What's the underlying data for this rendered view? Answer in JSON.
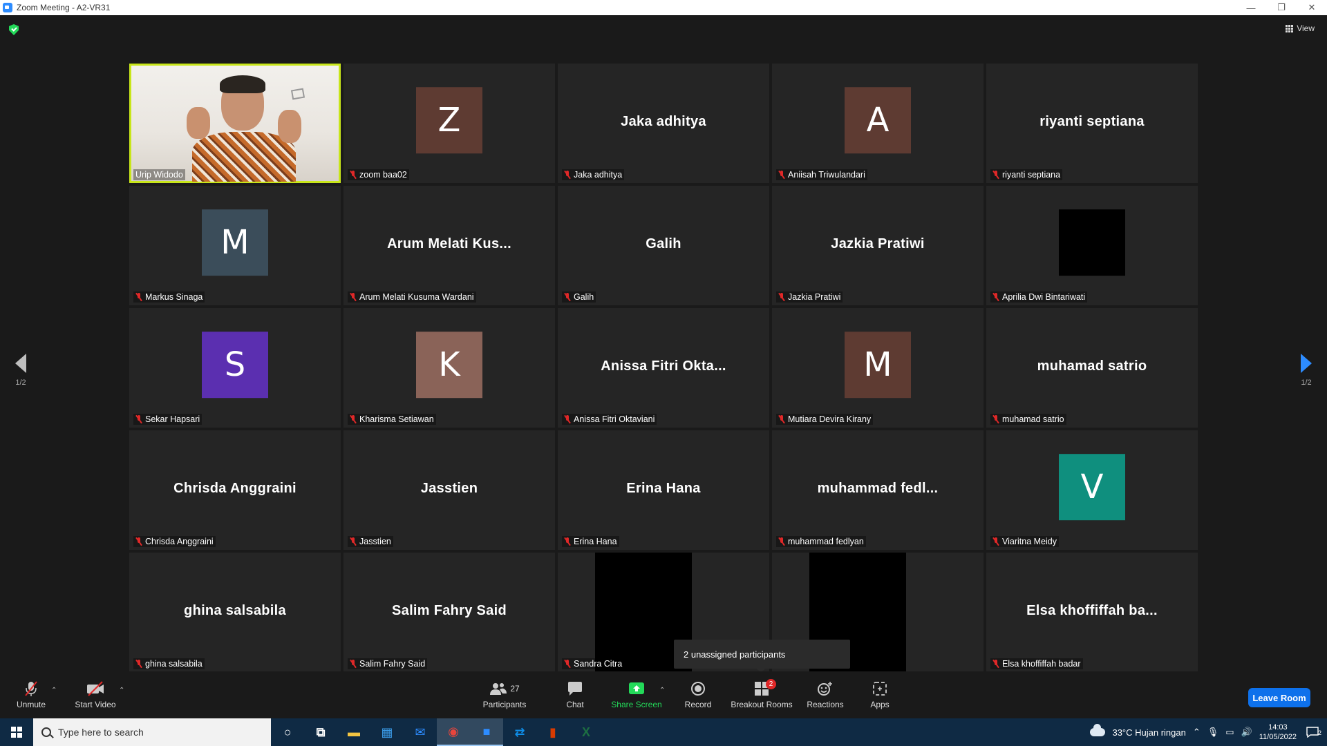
{
  "window": {
    "title": "Zoom Meeting - A2-VR31",
    "min_glyph": "—",
    "max_glyph": "❐",
    "close_glyph": "✕"
  },
  "meeting": {
    "view_label": "View",
    "page_indicator_left": "1/2",
    "page_indicator_right": "1/2",
    "tooltip": "2 unassigned participants"
  },
  "colors": {
    "active_border": "#c8e61a",
    "muted_mic": "#e02828",
    "leave_button": "#0e71eb",
    "share_screen": "#23d959"
  },
  "tiles": [
    {
      "name": "Urip Widodo",
      "type": "video",
      "active": true
    },
    {
      "name": "zoom baa02",
      "type": "avatar",
      "letter": "Z",
      "color": "#5e3b32"
    },
    {
      "name": "Jaka adhitya",
      "type": "text",
      "display": "Jaka adhitya"
    },
    {
      "name": "Aniisah Triwulandari",
      "type": "avatar",
      "letter": "A",
      "color": "#5e3b32"
    },
    {
      "name": "riyanti septiana",
      "type": "text",
      "display": "riyanti septiana"
    },
    {
      "name": "Markus Sinaga",
      "type": "avatar",
      "letter": "M",
      "color": "#3b4d5a"
    },
    {
      "name": "Arum Melati Kusuma Wardani",
      "type": "text",
      "display": "Arum Melati Kus..."
    },
    {
      "name": "Galih",
      "type": "text",
      "display": "Galih"
    },
    {
      "name": "Jazkia Pratiwi",
      "type": "text",
      "display": "Jazkia Pratiwi"
    },
    {
      "name": "Aprilia Dwi Bintariwati",
      "type": "black-center"
    },
    {
      "name": "Sekar Hapsari",
      "type": "avatar",
      "letter": "S",
      "color": "#5b2fb0"
    },
    {
      "name": "Kharisma Setiawan",
      "type": "avatar",
      "letter": "K",
      "color": "#8a6358"
    },
    {
      "name": "Anissa Fitri Oktaviani",
      "type": "text",
      "display": "Anissa Fitri Okta..."
    },
    {
      "name": "Mutiara Devira Kirany",
      "type": "avatar",
      "letter": "M",
      "color": "#5e3b32"
    },
    {
      "name": "muhamad satrio",
      "type": "text",
      "display": "muhamad satrio"
    },
    {
      "name": "Chrisda Anggraini",
      "type": "text",
      "display": "Chrisda Anggraini"
    },
    {
      "name": "Jasstien",
      "type": "text",
      "display": "Jasstien"
    },
    {
      "name": "Erina Hana",
      "type": "text",
      "display": "Erina Hana"
    },
    {
      "name": "muhammad fedlyan",
      "type": "text",
      "display": "muhammad fedl..."
    },
    {
      "name": "Viaritna Meidy",
      "type": "avatar",
      "letter": "V",
      "color": "#0f8f7e"
    },
    {
      "name": "ghina salsabila",
      "type": "text",
      "display": "ghina salsabila"
    },
    {
      "name": "Salim Fahry Said",
      "type": "text",
      "display": "Salim Fahry Said"
    },
    {
      "name": "Sandra Citra",
      "type": "black-video"
    },
    {
      "name": "",
      "type": "black-video"
    },
    {
      "name": "Elsa khoffiffah badar",
      "type": "text",
      "display": "Elsa khoffiffah ba..."
    }
  ],
  "toolbar": {
    "unmute": "Unmute",
    "start_video": "Start Video",
    "participants": "Participants",
    "participant_count": "27",
    "chat": "Chat",
    "share_screen": "Share Screen",
    "record": "Record",
    "breakout_rooms": "Breakout Rooms",
    "breakout_badge": "2",
    "reactions": "Reactions",
    "apps": "Apps",
    "leave": "Leave Room"
  },
  "taskbar": {
    "search_placeholder": "Type here to search",
    "weather": "33°C  Hujan ringan",
    "time": "14:03",
    "date": "11/05/2022",
    "notification_count": "2",
    "apps": [
      "cortana-icon",
      "task-view-icon",
      "file-explorer-icon",
      "store-icon",
      "mail-icon",
      "chrome-icon",
      "zoom-icon",
      "teamviewer-icon",
      "office-icon",
      "excel-icon"
    ]
  }
}
